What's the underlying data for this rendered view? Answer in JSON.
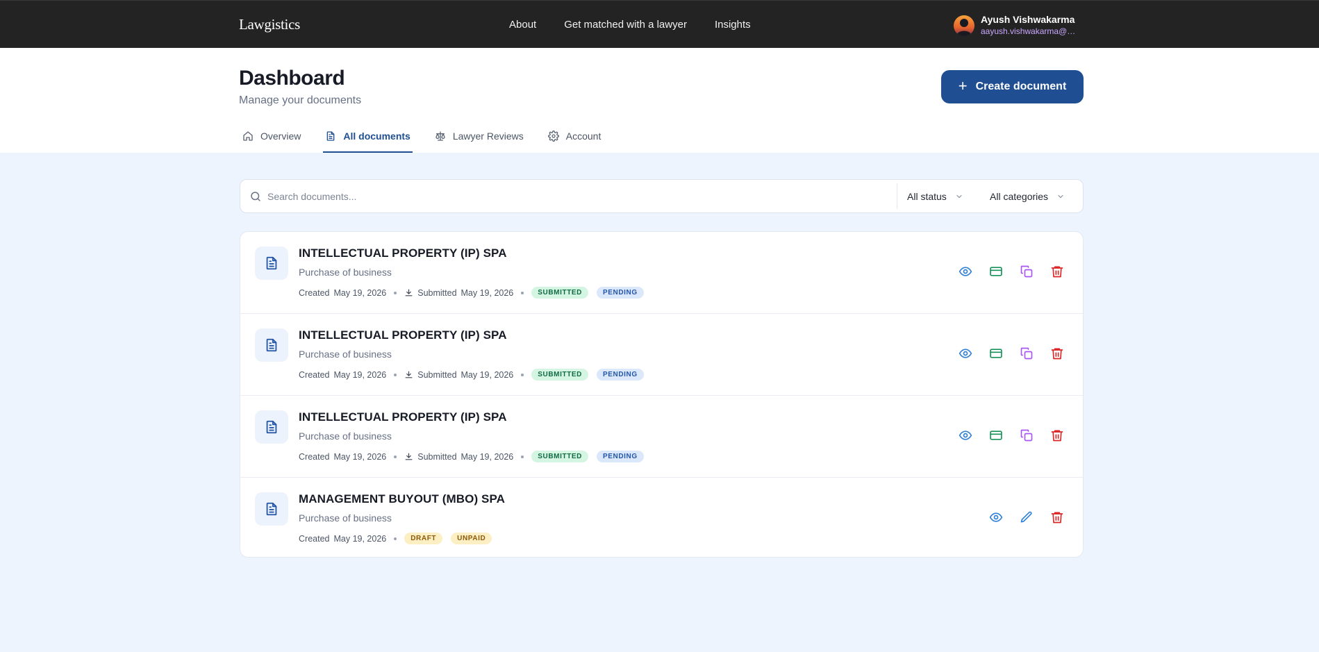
{
  "app": {
    "brand": "Lawgistics",
    "nav": [
      "About",
      "Get matched with a lawyer",
      "Insights"
    ],
    "user": {
      "name": "Ayush Vishwakarma",
      "email": "aayush.vishwakarma@gr..."
    }
  },
  "header": {
    "title": "Dashboard",
    "subtitle": "Manage your documents",
    "create_button": "Create document",
    "create_icon": "+"
  },
  "tabs": [
    {
      "label": "Overview",
      "icon": "home-icon",
      "active": false
    },
    {
      "label": "All documents",
      "icon": "document-icon",
      "active": true
    },
    {
      "label": "Lawyer Reviews",
      "icon": "scale-icon",
      "active": false
    },
    {
      "label": "Account",
      "icon": "gear-icon",
      "active": false
    }
  ],
  "search": {
    "placeholder": "Search documents...",
    "status_filter": "All status",
    "category_filter": "All categories"
  },
  "documents": [
    {
      "title": "INTELLECTUAL PROPERTY (IP) SPA",
      "category": "Purchase of business",
      "created_label": "Created",
      "created": "May 19, 2026",
      "submitted_label": "Submitted",
      "submitted": "May 19, 2026",
      "badges": [
        "SUBMITTED",
        "PENDING"
      ]
    },
    {
      "title": "INTELLECTUAL PROPERTY (IP) SPA",
      "category": "Purchase of business",
      "created_label": "Created",
      "created": "May 19, 2026",
      "submitted_label": "Submitted",
      "submitted": "May 19, 2026",
      "badges": [
        "SUBMITTED",
        "PENDING"
      ]
    },
    {
      "title": "INTELLECTUAL PROPERTY (IP) SPA",
      "category": "Purchase of business",
      "created_label": "Created",
      "created": "May 19, 2026",
      "submitted_label": "Submitted",
      "submitted": "May 19, 2026",
      "badges": [
        "SUBMITTED",
        "PENDING"
      ]
    },
    {
      "title": "MANAGEMENT BUYOUT (MBO) SPA",
      "category": "Purchase of business",
      "created_label": "Created",
      "created": "May 19, 2026",
      "badges": [
        "DRAFT",
        "UNPAID"
      ]
    }
  ],
  "colors": {
    "brand_blue": "#1f4f92",
    "nav_bg": "#232323",
    "page_bg": "#eef4fe",
    "view_icon": "#2f80d6",
    "payment_icon": "#17935a",
    "copy_icon": "#a855f7",
    "delete_icon": "#dc2626",
    "edit_icon": "#2f80d6"
  }
}
